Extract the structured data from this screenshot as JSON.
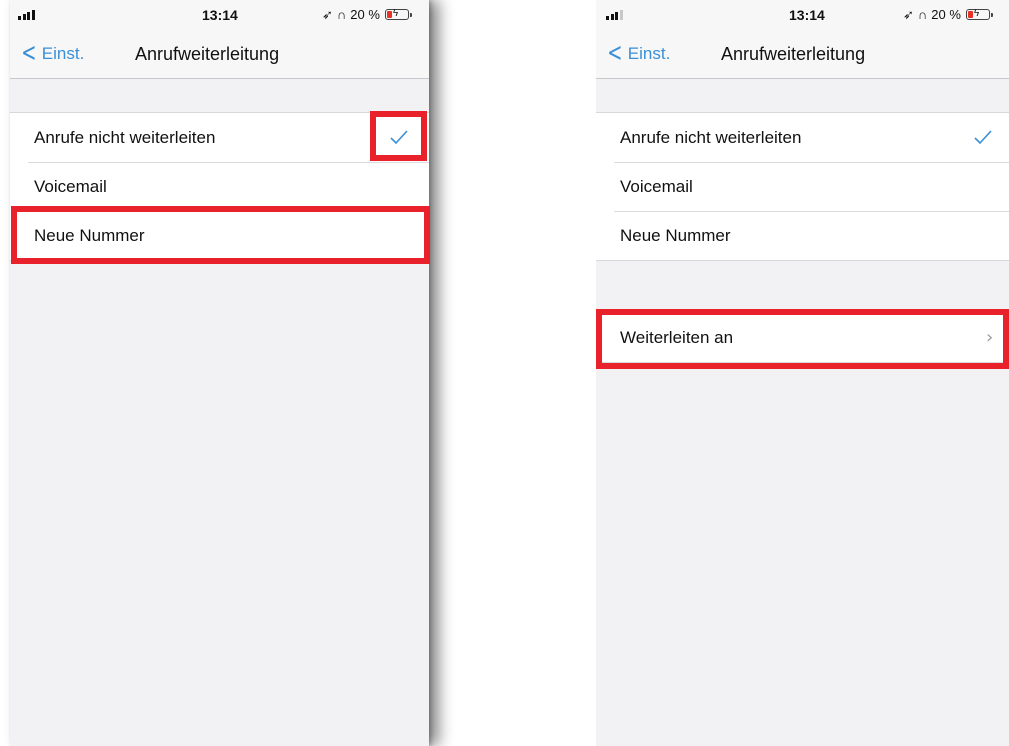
{
  "screens": {
    "left": {
      "status": {
        "time": "13:14",
        "battery": "20 %"
      },
      "nav": {
        "back_label": "Einst.",
        "title": "Anrufweiterleitung"
      },
      "options": [
        {
          "label": "Anrufe nicht weiterleiten",
          "checked": true
        },
        {
          "label": "Voicemail",
          "checked": false
        },
        {
          "label": "Neue Nummer",
          "checked": false
        }
      ]
    },
    "right": {
      "status": {
        "time": "13:14",
        "battery": "20 %"
      },
      "nav": {
        "back_label": "Einst.",
        "title": "Anrufweiterleitung"
      },
      "options": [
        {
          "label": "Anrufe nicht weiterleiten",
          "checked": true
        },
        {
          "label": "Voicemail",
          "checked": false
        },
        {
          "label": "Neue Nummer",
          "checked": false
        }
      ],
      "forward_to": {
        "label": "Weiterleiten an"
      }
    }
  },
  "icons": {
    "location": "location-arrow-icon",
    "headphones": "headphones-icon",
    "battery": "battery-charging-icon",
    "check": "checkmark-icon",
    "back": "chevron-left-icon",
    "disclosure": "chevron-right-icon"
  },
  "colors": {
    "accent": "#3a8fd6",
    "highlight": "#e8212b",
    "battery_low": "#e63325"
  }
}
